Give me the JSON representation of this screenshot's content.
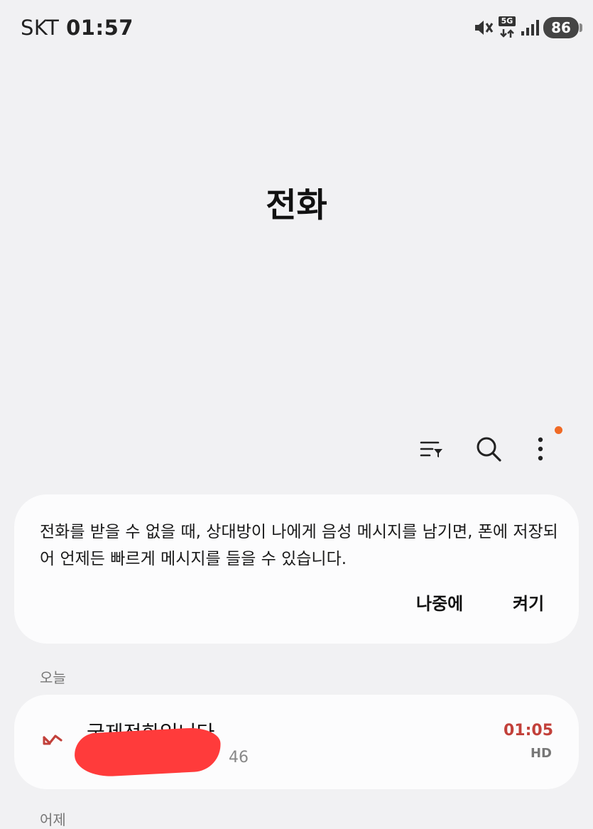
{
  "status_bar": {
    "carrier": "SKT",
    "time": "01:57",
    "network": "5G",
    "battery": "86"
  },
  "page": {
    "title": "전화"
  },
  "toolbar": {
    "filter_icon": "filter-list-icon",
    "search_icon": "search-icon",
    "more_icon": "more-vertical-icon",
    "badge_color": "#f06a25"
  },
  "voicemail_card": {
    "message": "전화를 받을 수 없을 때, 상대방이 나에게 음성 메시지를 남기면, 폰에 저장되어 언제든 빠르게 메시지를 들을 수 있습니다.",
    "later_label": "나중에",
    "enable_label": "켜기"
  },
  "sections": {
    "today_label": "오늘",
    "yesterday_label": "어제"
  },
  "calls": [
    {
      "name": "국제전화입니다",
      "number_visible": "0",
      "number_tail": "46",
      "time": "01:05",
      "quality": "HD",
      "type_icon": "missed-call-icon",
      "accent_color": "#c2403a"
    }
  ]
}
